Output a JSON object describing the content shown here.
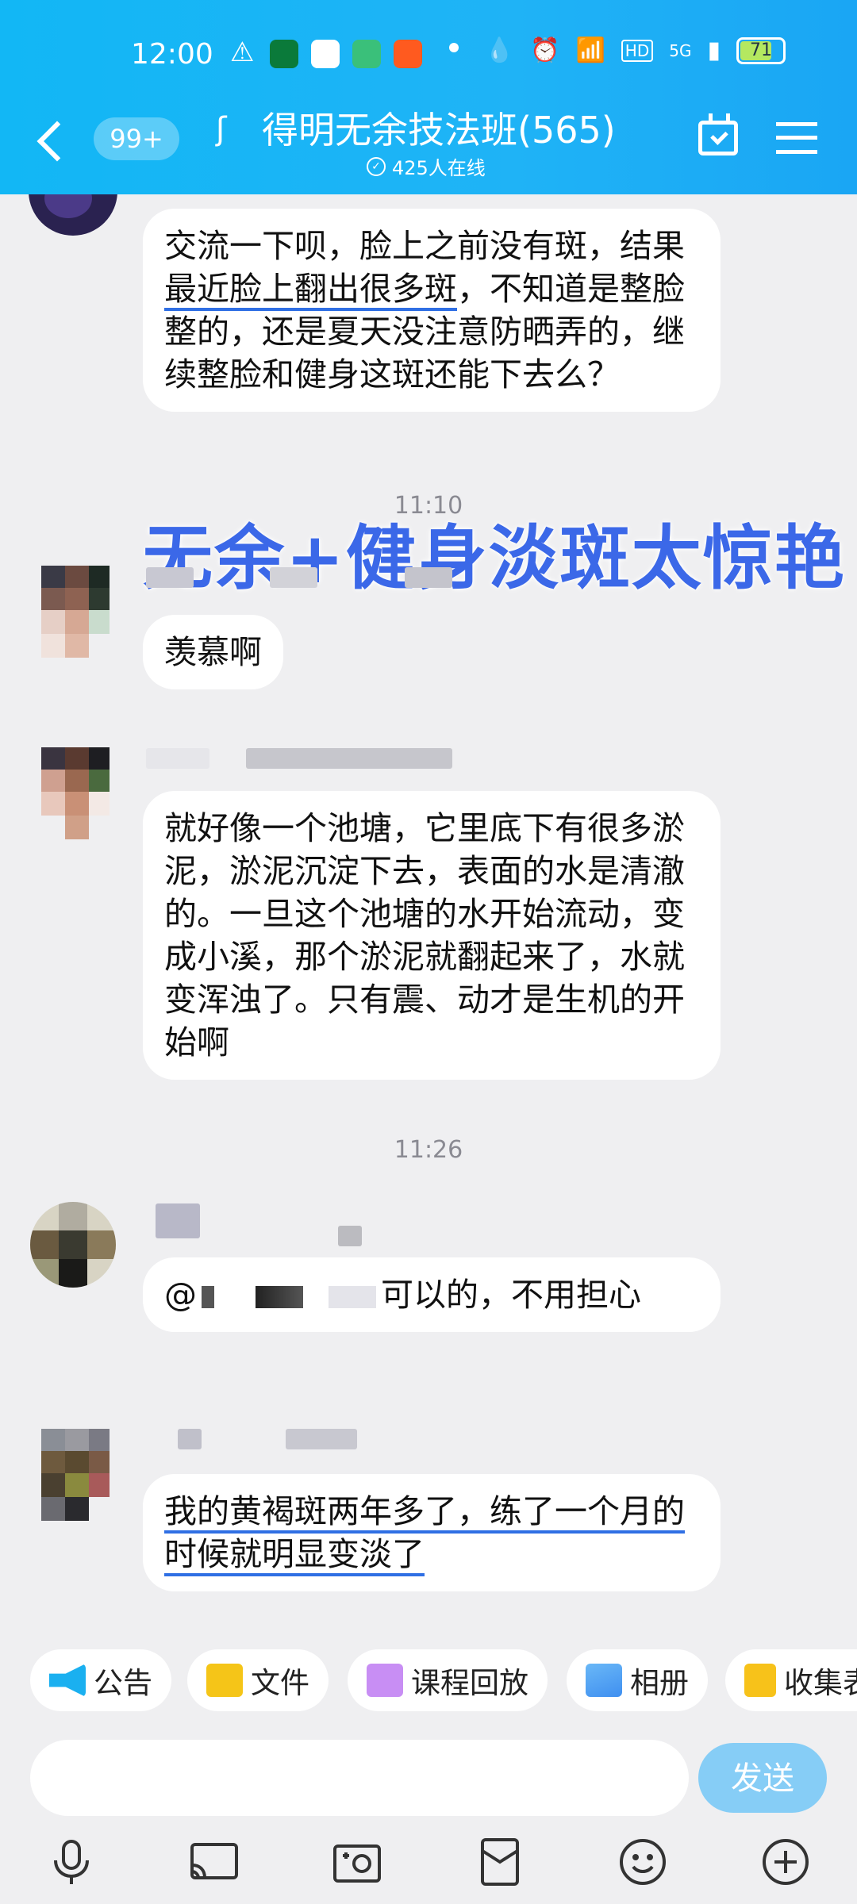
{
  "status_bar": {
    "time": "12:00",
    "network_labels": [
      "HD",
      "5G"
    ],
    "battery": "71"
  },
  "header": {
    "unread_badge": "99+",
    "group_title": "得明无余技法班(565)",
    "online_count": "425人在线"
  },
  "overlay_caption": "无余+健身淡斑太惊艳",
  "messages": [
    {
      "text_before": "交流一下呗，脸上之前没有斑，结果",
      "underlined": "最近脸上翻出很多斑",
      "text_after": "，不知道是整脸整的，还是夏天没注意防晒弄的，继续整脸和健身这斑还能下去么？"
    },
    {
      "timestamp": "11:10"
    },
    {
      "text": "羡慕啊"
    },
    {
      "text": "就好像一个池塘，它里底下有很多淤泥，淤泥沉淀下去，表面的水是清澈的。一旦这个池塘的水开始流动，变成小溪，那个淤泥就翻起来了，水就变浑浊了。只有震、动才是生机的开始啊"
    },
    {
      "timestamp": "11:26"
    },
    {
      "mention_prefix": "@",
      "text": "可以的，不用担心"
    },
    {
      "underlined": "我的黄褐斑两年多了，练了一个月的时候就明显变淡了"
    }
  ],
  "shortcuts": [
    {
      "label": "公告",
      "icon": "megaphone-icon"
    },
    {
      "label": "文件",
      "icon": "folder-icon"
    },
    {
      "label": "课程回放",
      "icon": "video-replay-icon"
    },
    {
      "label": "相册",
      "icon": "photo-album-icon"
    },
    {
      "label": "收集表",
      "icon": "form-icon"
    }
  ],
  "input": {
    "placeholder": "",
    "send_label": "发送"
  },
  "toolbar_icons": [
    "microphone-icon",
    "screen-cast-icon",
    "camera-icon",
    "red-packet-icon",
    "emoji-icon",
    "plus-icon"
  ],
  "colors": {
    "header": "#12b7f5",
    "underline": "#2f6fe4",
    "caption": "#3b68e8",
    "send_button": "#86cdf6"
  }
}
